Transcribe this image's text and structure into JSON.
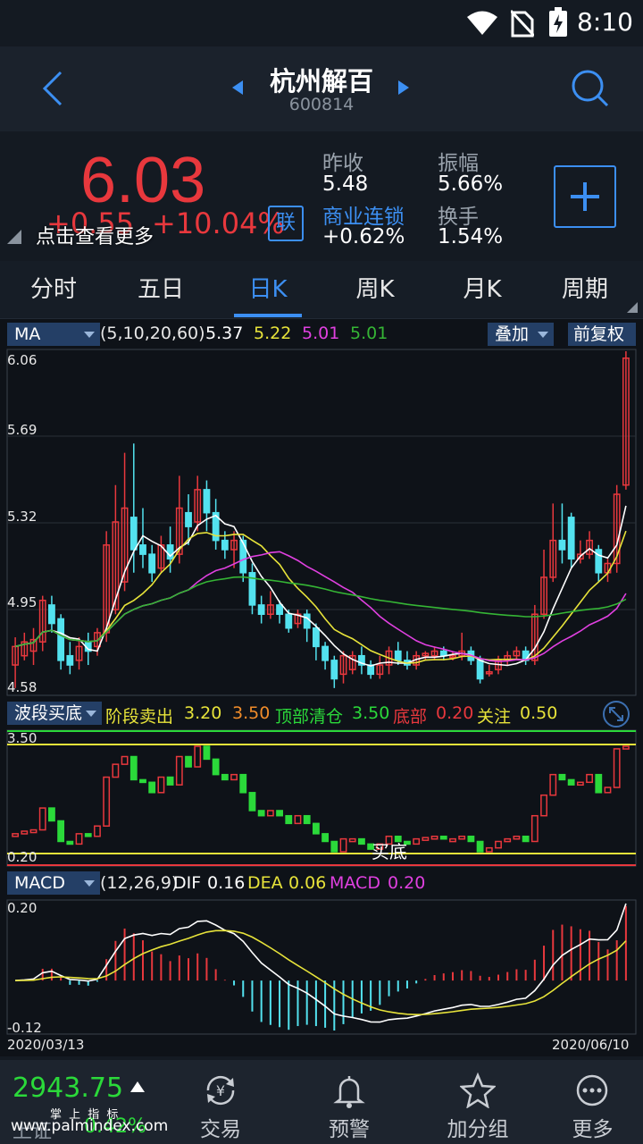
{
  "status": {
    "time": "8:10"
  },
  "header": {
    "title": "杭州解百",
    "code": "600814"
  },
  "quote": {
    "price": "6.03",
    "change": "+0.55",
    "change_pct": "+10.04%",
    "link_badge": "联",
    "tap_hint": "点击查看更多",
    "prev_close_label": "昨收",
    "prev_close": "5.48",
    "amplitude_label": "振幅",
    "amplitude": "5.66%",
    "sector_label": "商业连锁",
    "sector_change": "+0.62%",
    "turnover_label": "换手",
    "turnover": "1.54%",
    "colors": {
      "up": "#e8383d",
      "accent": "#3c8ff2"
    }
  },
  "tabs": [
    {
      "label": "分时"
    },
    {
      "label": "五日"
    },
    {
      "label": "日K"
    },
    {
      "label": "周K"
    },
    {
      "label": "月K"
    },
    {
      "label": "周期"
    }
  ],
  "active_tab": "日K",
  "ma_panel": {
    "dropdown": "MA",
    "params": "(5,10,20,60)",
    "values": [
      "5.37",
      "5.22",
      "5.01",
      "5.01"
    ],
    "overlay_btn": "叠加",
    "adjust_btn": "前复权",
    "axis_labels": [
      "6.06",
      "5.69",
      "5.32",
      "4.95",
      "4.58"
    ]
  },
  "band_panel": {
    "dropdown": "波段买底",
    "stage_sell_label": "阶段卖出",
    "stage_sell_1": "3.20",
    "stage_sell_2": "3.50",
    "top_clear_label": "顶部清仓",
    "top_clear": "3.50",
    "bottom_label": "底部",
    "bottom": "0.20",
    "watch_label": "关注",
    "watch": "0.50",
    "axis_top": "3.50",
    "axis_bottom": "0.20",
    "annotation": "买底"
  },
  "macd_panel": {
    "dropdown": "MACD",
    "params": "(12,26,9)",
    "dif_label": "DIF",
    "dif": "0.16",
    "dea_label": "DEA",
    "dea": "0.06",
    "macd_label": "MACD",
    "macd": "0.20",
    "axis_top": "0.20",
    "axis_bottom": "-0.12",
    "date_start": "2020/03/13",
    "date_end": "2020/06/10"
  },
  "bottom_nav": {
    "index_value": "2943.75",
    "index_name": "上证",
    "index_change": "0.42%",
    "watermark_top": "掌 上 指 标",
    "watermark": "www.palmindex.com",
    "items": [
      {
        "label": "交易"
      },
      {
        "label": "预警"
      },
      {
        "label": "加分组"
      },
      {
        "label": "更多"
      }
    ]
  },
  "chart_data": {
    "type": "candlestick",
    "ylim": [
      4.58,
      6.06
    ],
    "x_range": [
      "2020/03/13",
      "2020/06/10"
    ],
    "candles": [
      [
        4.7,
        4.78,
        4.6,
        4.82
      ],
      [
        4.74,
        4.8,
        4.72,
        4.84
      ],
      [
        4.76,
        4.81,
        4.7,
        4.86
      ],
      [
        4.8,
        4.98,
        4.76,
        5.0
      ],
      [
        4.96,
        4.88,
        4.84,
        5.0
      ],
      [
        4.9,
        4.72,
        4.68,
        4.92
      ],
      [
        4.74,
        4.7,
        4.66,
        4.8
      ],
      [
        4.72,
        4.78,
        4.68,
        4.82
      ],
      [
        4.8,
        4.76,
        4.7,
        4.84
      ],
      [
        4.78,
        4.84,
        4.74,
        4.86
      ],
      [
        4.84,
        5.22,
        4.8,
        5.28
      ],
      [
        4.94,
        5.32,
        4.92,
        5.48
      ],
      [
        5.06,
        5.38,
        5.02,
        5.62
      ],
      [
        5.34,
        5.2,
        5.1,
        5.66
      ],
      [
        5.22,
        5.18,
        5.12,
        5.38
      ],
      [
        5.18,
        5.1,
        5.06,
        5.22
      ],
      [
        5.12,
        5.22,
        5.1,
        5.26
      ],
      [
        5.22,
        5.16,
        5.1,
        5.3
      ],
      [
        5.18,
        5.38,
        5.14,
        5.52
      ],
      [
        5.36,
        5.3,
        5.22,
        5.44
      ],
      [
        5.32,
        5.46,
        5.28,
        5.52
      ],
      [
        5.46,
        5.36,
        5.28,
        5.5
      ],
      [
        5.36,
        5.24,
        5.2,
        5.42
      ],
      [
        5.24,
        5.2,
        5.16,
        5.28
      ],
      [
        5.2,
        5.24,
        5.12,
        5.28
      ],
      [
        5.24,
        5.1,
        5.06,
        5.26
      ],
      [
        5.1,
        4.96,
        4.92,
        5.14
      ],
      [
        4.96,
        4.92,
        4.88,
        5.0
      ],
      [
        4.92,
        4.96,
        4.9,
        5.02
      ],
      [
        4.96,
        4.92,
        4.88,
        4.98
      ],
      [
        4.92,
        4.86,
        4.84,
        4.94
      ],
      [
        4.88,
        4.92,
        4.86,
        4.94
      ],
      [
        4.92,
        4.86,
        4.8,
        4.94
      ],
      [
        4.86,
        4.78,
        4.72,
        4.88
      ],
      [
        4.78,
        4.72,
        4.68,
        4.8
      ],
      [
        4.72,
        4.64,
        4.6,
        4.74
      ],
      [
        4.66,
        4.74,
        4.62,
        4.76
      ],
      [
        4.68,
        4.74,
        4.66,
        4.76
      ],
      [
        4.74,
        4.7,
        4.66,
        4.78
      ],
      [
        4.7,
        4.66,
        4.64,
        4.72
      ],
      [
        4.66,
        4.7,
        4.64,
        4.74
      ],
      [
        4.7,
        4.76,
        4.66,
        4.78
      ],
      [
        4.76,
        4.72,
        4.7,
        4.8
      ],
      [
        4.72,
        4.7,
        4.68,
        4.76
      ],
      [
        4.7,
        4.74,
        4.68,
        4.76
      ],
      [
        4.74,
        4.75,
        4.72,
        4.76
      ],
      [
        4.74,
        4.76,
        4.72,
        4.78
      ],
      [
        4.76,
        4.74,
        4.72,
        4.78
      ],
      [
        4.74,
        4.74,
        4.72,
        4.76
      ],
      [
        4.74,
        4.76,
        4.72,
        4.84
      ],
      [
        4.76,
        4.72,
        4.7,
        4.78
      ],
      [
        4.72,
        4.64,
        4.62,
        4.74
      ],
      [
        4.67,
        4.67,
        4.65,
        4.7
      ],
      [
        4.68,
        4.72,
        4.66,
        4.74
      ],
      [
        4.72,
        4.74,
        4.7,
        4.76
      ],
      [
        4.74,
        4.76,
        4.72,
        4.78
      ],
      [
        4.76,
        4.72,
        4.7,
        4.78
      ],
      [
        4.72,
        4.92,
        4.7,
        4.96
      ],
      [
        4.92,
        5.08,
        4.9,
        5.2
      ],
      [
        5.08,
        5.24,
        5.06,
        5.4
      ],
      [
        5.24,
        5.2,
        5.14,
        5.4
      ],
      [
        5.34,
        5.16,
        5.12,
        5.36
      ],
      [
        5.16,
        5.18,
        5.14,
        5.24
      ],
      [
        5.18,
        5.24,
        5.16,
        5.28
      ],
      [
        5.2,
        5.1,
        5.06,
        5.22
      ],
      [
        5.1,
        5.14,
        5.06,
        5.16
      ],
      [
        5.14,
        5.44,
        5.1,
        5.48
      ],
      [
        5.48,
        6.03,
        5.46,
        6.06
      ]
    ]
  }
}
